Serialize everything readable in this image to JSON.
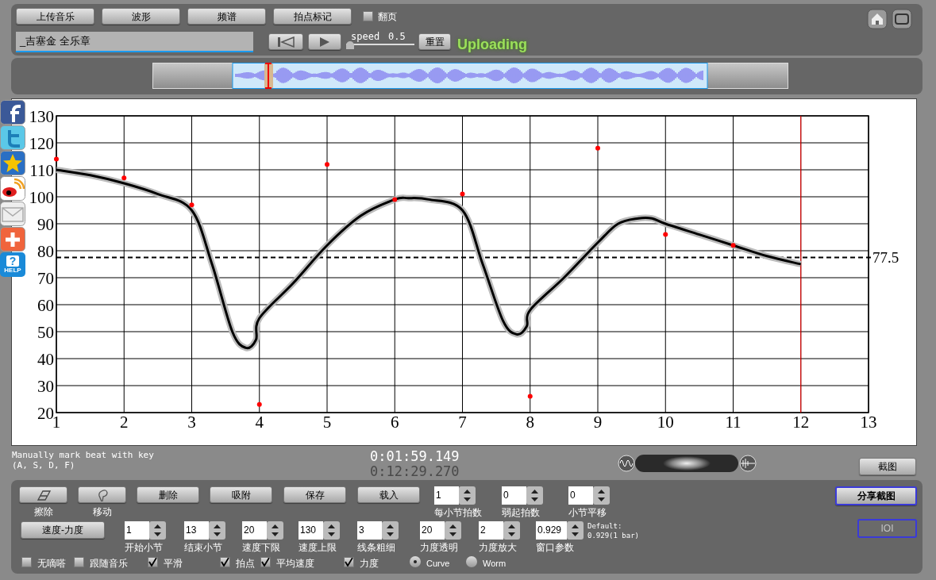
{
  "toolbar": {
    "buttons": [
      "上传音乐",
      "波形",
      "频谱",
      "拍点标记"
    ],
    "page_turn": {
      "label": "翻页",
      "checked": false
    }
  },
  "file_field": {
    "value": "_吉塞金 全乐章"
  },
  "speed": {
    "label": "speed",
    "value": "0.5",
    "level": 0
  },
  "reset_button": "重置",
  "status": "Uploading",
  "chart": {
    "chart_data": {
      "type": "line",
      "x": [
        1,
        1.5,
        2,
        2.5,
        3,
        3.3,
        3.6,
        3.8,
        3.95,
        4,
        4.5,
        5,
        5.5,
        6,
        6.2,
        6.5,
        7,
        7.3,
        7.6,
        7.8,
        7.95,
        8,
        8.5,
        9,
        9.3,
        9.6,
        9.8,
        10,
        10.5,
        11,
        11.5,
        12
      ],
      "series": [
        {
          "color": "#000000",
          "values": [
            110,
            108,
            105,
            101,
            95,
            75,
            50,
            44,
            47,
            55,
            68,
            82,
            93,
            99,
            99.5,
            99,
            95,
            75,
            54,
            49,
            52,
            58,
            70,
            83,
            90,
            92,
            92,
            90,
            86,
            82,
            78,
            75
          ]
        },
        {
          "type": "scatter",
          "color": "#ff0000",
          "values": [
            114,
            null,
            107,
            null,
            97,
            null,
            null,
            null,
            null,
            23,
            null,
            112,
            null,
            99,
            null,
            null,
            101,
            null,
            null,
            null,
            null,
            26,
            null,
            118,
            null,
            null,
            null,
            86,
            null,
            82,
            null,
            null
          ]
        }
      ],
      "xlim": [
        1,
        13
      ],
      "ylim": [
        20,
        130
      ],
      "xticks": [
        1,
        2,
        3,
        4,
        5,
        6,
        7,
        8,
        9,
        10,
        11,
        12,
        13
      ],
      "yticks": [
        20,
        30,
        40,
        50,
        60,
        70,
        80,
        90,
        100,
        110,
        120,
        130
      ],
      "grid": true,
      "ref_lines": [
        {
          "axis": "y",
          "value": 77.5,
          "label": "77.5"
        },
        {
          "axis": "x",
          "value": 12,
          "color": "#ff0000"
        }
      ]
    }
  },
  "zoom_slider": {
    "level": 0.5
  },
  "hint": [
    "Manually mark beat with key",
    "(A, S, D, F)"
  ],
  "times": {
    "current": "0:01:59.149",
    "total": "0:12:29.270"
  },
  "screenshot_button": "截图",
  "tool_buttons": [
    {
      "kind": "eraser",
      "label": "擦除"
    },
    {
      "kind": "move",
      "label": "移动"
    }
  ],
  "action_buttons": [
    "删除",
    "吸附",
    "保存",
    "载入"
  ],
  "spinners_top": [
    {
      "value": "1",
      "label": "每小节拍数"
    },
    {
      "value": "0",
      "label": "弱起拍数"
    },
    {
      "value": "0",
      "label": "小节平移"
    }
  ],
  "share_button": "分享截图",
  "ioi_button": {
    "label": "IOI",
    "disabled": true
  },
  "mode_button": "速度-力度",
  "spinners": [
    {
      "value": "1",
      "label": "开始小节"
    },
    {
      "value": "13",
      "label": "结束小节"
    },
    {
      "value": "20",
      "label": "速度下限"
    },
    {
      "value": "130",
      "label": "速度上限"
    },
    {
      "value": "3",
      "label": "线条粗细"
    },
    {
      "value": "20",
      "label": "力度透明"
    },
    {
      "value": "2",
      "label": "力度放大"
    },
    {
      "value": "0.929",
      "label": "窗口参数"
    }
  ],
  "default_note": [
    "Default:",
    "0.929(1 bar)"
  ],
  "checkboxes": [
    {
      "label": "无嘀嗒",
      "checked": false
    },
    {
      "label": "跟随音乐",
      "checked": false
    },
    {
      "label": "平滑",
      "checked": true
    },
    {
      "label": "拍点",
      "checked": true
    },
    {
      "label": "平均速度",
      "checked": true
    },
    {
      "label": "力度",
      "checked": true
    }
  ],
  "radios": [
    {
      "label": "Curve",
      "selected": true
    },
    {
      "label": "Worm",
      "selected": false
    }
  ],
  "help_icon": {
    "symbol": "?",
    "label": "HELP"
  }
}
